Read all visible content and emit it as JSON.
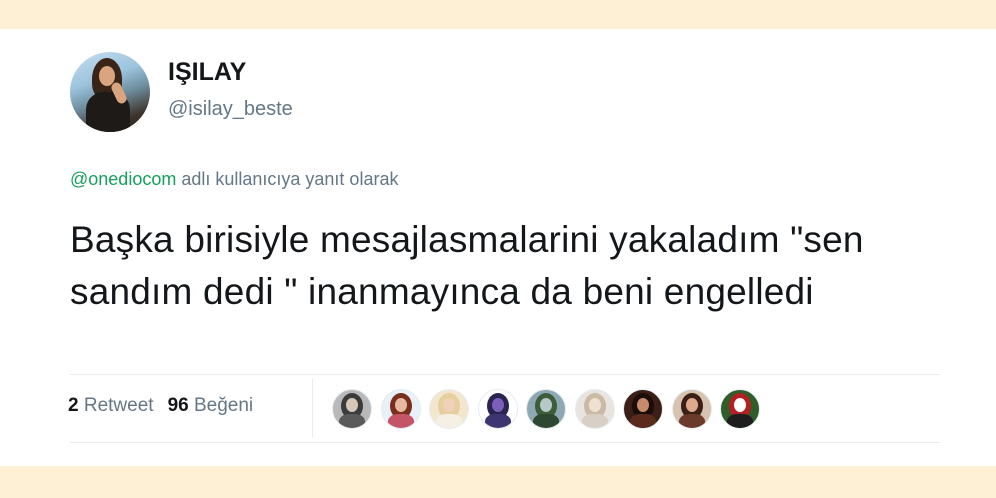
{
  "tweet": {
    "display_name": "IŞILAY",
    "handle": "@isilay_beste",
    "reply_mention": "@onediocom",
    "reply_suffix": " adlı kullanıcıya yanıt olarak",
    "text": "Başka birisiyle mesajlasmalarini yakaladım \"sen sandım dedi \" inanmayınca da beni engelledi"
  },
  "stats": {
    "retweet_count": "2",
    "retweet_label": "Retweet",
    "like_count": "96",
    "like_label": "Beğeni"
  },
  "likers": [
    {
      "name": "liker-avatar-1",
      "bg": "#b9b9b9",
      "hair": "#3b3b3b",
      "skin": "#d6c7b8",
      "body": "#5a5a5a"
    },
    {
      "name": "liker-avatar-2",
      "bg": "#e8f1f7",
      "hair": "#7a2e1d",
      "skin": "#e7b9a0",
      "body": "#c45568"
    },
    {
      "name": "liker-avatar-3",
      "bg": "#f2e6cf",
      "hair": "#e5cf9f",
      "skin": "#f0d2b8",
      "body": "#f6efe3"
    },
    {
      "name": "liker-avatar-4",
      "bg": "#ffffff",
      "hair": "#2a2550",
      "skin": "#7b5fb8",
      "body": "#3c3570"
    },
    {
      "name": "liker-avatar-5",
      "bg": "#8ea9b4",
      "hair": "#3d5c3a",
      "skin": "#b7c8c9",
      "body": "#2e4730"
    },
    {
      "name": "liker-avatar-6",
      "bg": "#e9e4df",
      "hair": "#c9b9a6",
      "skin": "#efe1d1",
      "body": "#d8d0c6"
    },
    {
      "name": "liker-avatar-7",
      "bg": "#3b1f17",
      "hair": "#1b0d08",
      "skin": "#c98a6a",
      "body": "#5a2b1c"
    },
    {
      "name": "liker-avatar-8",
      "bg": "#d8c2b0",
      "hair": "#3a2016",
      "skin": "#e0a98b",
      "body": "#6a3b2a"
    },
    {
      "name": "liker-avatar-9",
      "bg": "#2f5e2a",
      "hair": "#b31f24",
      "skin": "#ffffff",
      "body": "#1e1e1e"
    }
  ]
}
